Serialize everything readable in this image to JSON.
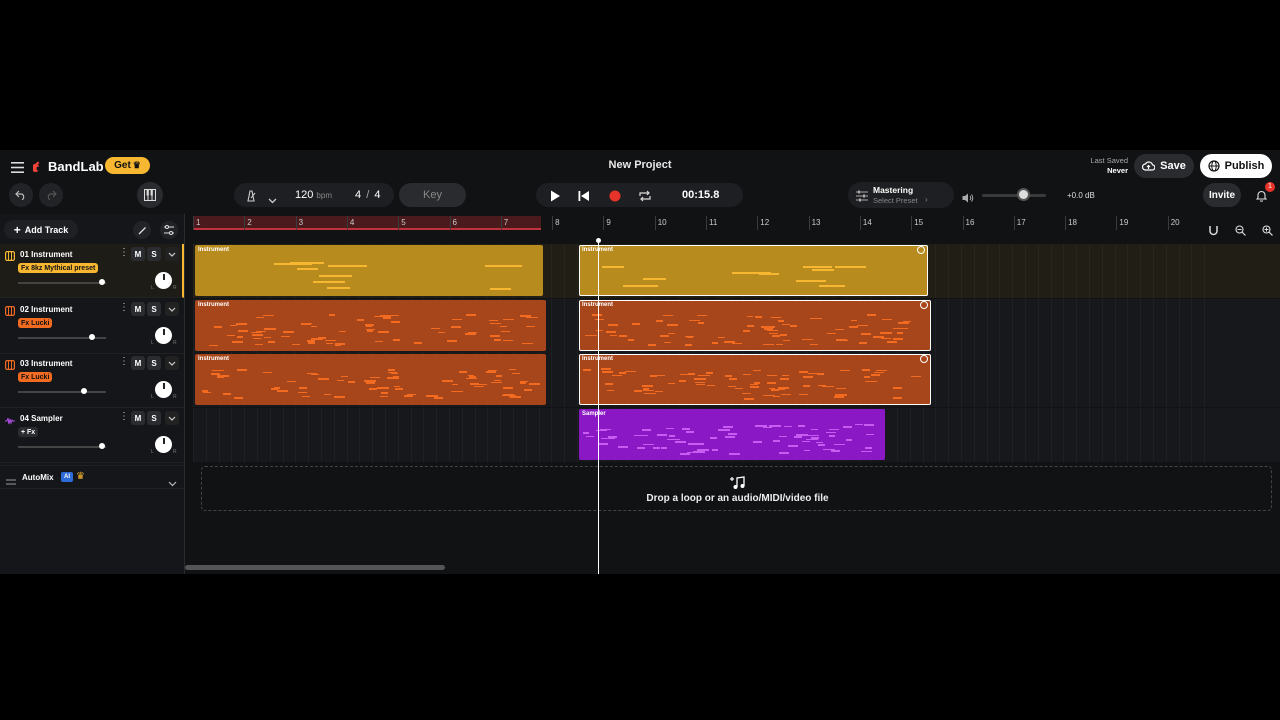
{
  "header": {
    "brand": "BandLab",
    "get_label": "Get",
    "project_title": "New Project",
    "last_saved_label": "Last Saved",
    "last_saved_value": "Never",
    "save_label": "Save",
    "publish_label": "Publish"
  },
  "toolbar": {
    "tempo": "120",
    "tempo_unit": "bpm",
    "time_sig_num": "4",
    "time_sig_sep": "/",
    "time_sig_den": "4",
    "key_label": "Key",
    "time": "00:15.8",
    "mastering_title": "Mastering",
    "mastering_sub": "Select Preset",
    "volume_db": "+0.0 dB",
    "invite_label": "Invite",
    "notification_count": "1"
  },
  "tracks_panel": {
    "add_track_label": "Add Track",
    "tracks": [
      {
        "name": "01  Instrument",
        "fx": "Fx 8kz Mythical preset",
        "fx_color": "#f7b731",
        "icon_color": "#f7b731",
        "volume": 0.96
      },
      {
        "name": "02  Instrument",
        "fx": "Fx Lucki",
        "fx_color": "#f26b21",
        "icon_color": "#f26b21",
        "volume": 0.84
      },
      {
        "name": "03  Instrument",
        "fx": "Fx Lucki",
        "fx_color": "#f26b21",
        "icon_color": "#f26b21",
        "volume": 0.75
      },
      {
        "name": "04  Sampler",
        "fx": "+ Fx",
        "fx_color": "#2b2c30",
        "icon_color": "#b34ee8",
        "volume": 0.96
      }
    ],
    "mute_label": "M",
    "solo_label": "S",
    "automix_label": "AutoMix",
    "ai_badge": "AI"
  },
  "timeline": {
    "bars": [
      "1",
      "2",
      "3",
      "4",
      "5",
      "6",
      "7",
      "8",
      "9",
      "10",
      "11",
      "12",
      "13",
      "14",
      "15",
      "16",
      "17",
      "18",
      "19",
      "20"
    ],
    "clip_label_instrument": "Instrument",
    "clip_label_sampler": "Sampler",
    "drop_text": "Drop a loop or an audio/MIDI/video file"
  },
  "colors": {
    "accent": "#f7b731",
    "orange": "#f26b21",
    "purple": "#9b1fd6",
    "record": "#e5332a"
  }
}
